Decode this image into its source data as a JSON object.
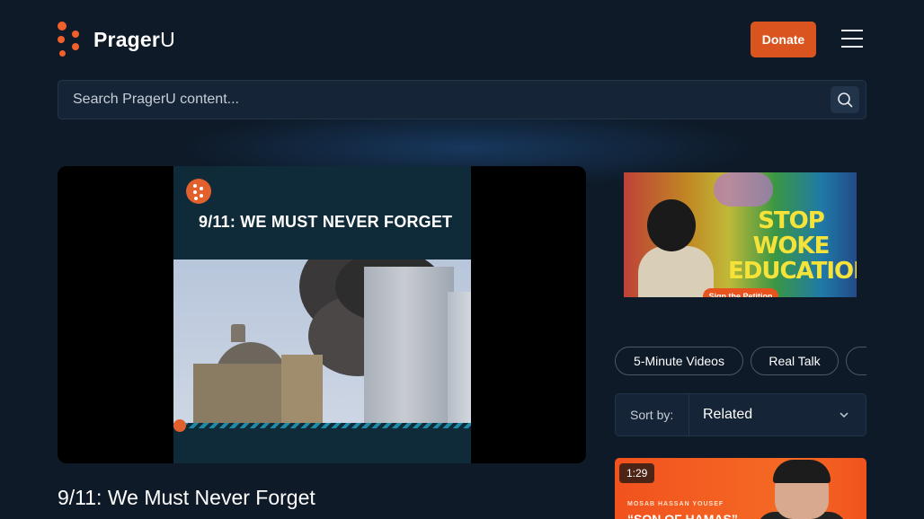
{
  "header": {
    "brand": "Prager",
    "brand_suffix": "U",
    "donate_label": "Donate"
  },
  "search": {
    "placeholder": "Search PragerU content..."
  },
  "video": {
    "frame_title": "9/11: WE MUST NEVER FORGET",
    "title": "9/11: We Must Never Forget"
  },
  "banner": {
    "headline_line1": "STOP WOKE",
    "headline_line2": "EDUCATION",
    "cta": "Sign the Petition"
  },
  "categories": [
    {
      "label": "5-Minute Videos"
    },
    {
      "label": "Real Talk"
    },
    {
      "label": ""
    }
  ],
  "sort": {
    "label": "Sort by:",
    "value": "Related"
  },
  "thumbnail": {
    "duration": "1:29",
    "name": "MOSAB HASSAN YOUSEF",
    "quote": "“SON OF HAMAS”"
  },
  "colors": {
    "background": "#0e1a28",
    "accent": "#d9541e",
    "panel": "#152436"
  }
}
